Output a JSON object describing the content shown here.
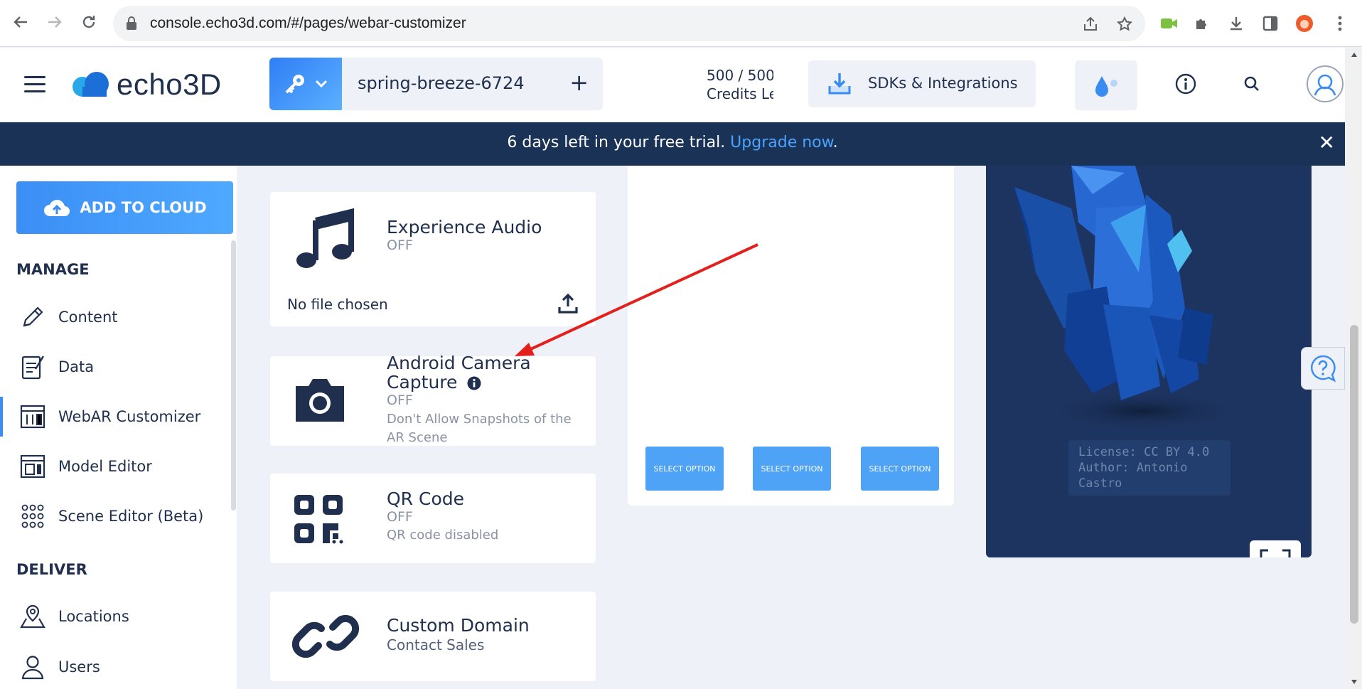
{
  "browser": {
    "url": "console.echo3d.com/#/pages/webar-customizer"
  },
  "header": {
    "logo_text": "echo3D",
    "project_name": "spring-breeze-6724",
    "project_add": "+",
    "credits_line1": "500 / 500",
    "credits_line2": "Credits Left",
    "sdk_label": "SDKs & Integrations"
  },
  "banner": {
    "text": "6 days left in your free trial. ",
    "link": "Upgrade now",
    "period": ".",
    "close": "✕"
  },
  "sidebar": {
    "add_cloud": "ADD TO CLOUD",
    "manage_title": "MANAGE",
    "deliver_title": "DELIVER",
    "items": [
      {
        "label": "Content",
        "icon": "pencil-icon"
      },
      {
        "label": "Data",
        "icon": "clipboard-icon"
      },
      {
        "label": "WebAR Customizer",
        "icon": "webar-icon",
        "active": true
      },
      {
        "label": "Model Editor",
        "icon": "model-editor-icon"
      },
      {
        "label": "Scene Editor (Beta)",
        "icon": "grid-dots-icon"
      },
      {
        "label": "Locations",
        "icon": "map-pin-icon"
      },
      {
        "label": "Users",
        "icon": "user-icon"
      }
    ]
  },
  "cards": {
    "audio": {
      "title": "Experience Audio",
      "status": "OFF",
      "file": "No file chosen"
    },
    "camera": {
      "title_line1": "Android Camera",
      "title_line2": "Capture",
      "status": "OFF",
      "desc": "Don't Allow Snapshots of the AR Scene"
    },
    "qr": {
      "title": "QR Code",
      "status": "OFF",
      "desc": "QR code disabled"
    },
    "domain": {
      "title": "Custom Domain",
      "desc": "Contact Sales"
    }
  },
  "options": {
    "buttons": [
      "SELECT OPTION",
      "SELECT OPTION",
      "SELECT OPTION"
    ]
  },
  "preview": {
    "license": "License: CC BY 4.0",
    "author": "Author: Antonio Castro"
  },
  "colors": {
    "accent": "#3b8ef5",
    "navy": "#1a3256",
    "annotation": "#e3201b"
  }
}
